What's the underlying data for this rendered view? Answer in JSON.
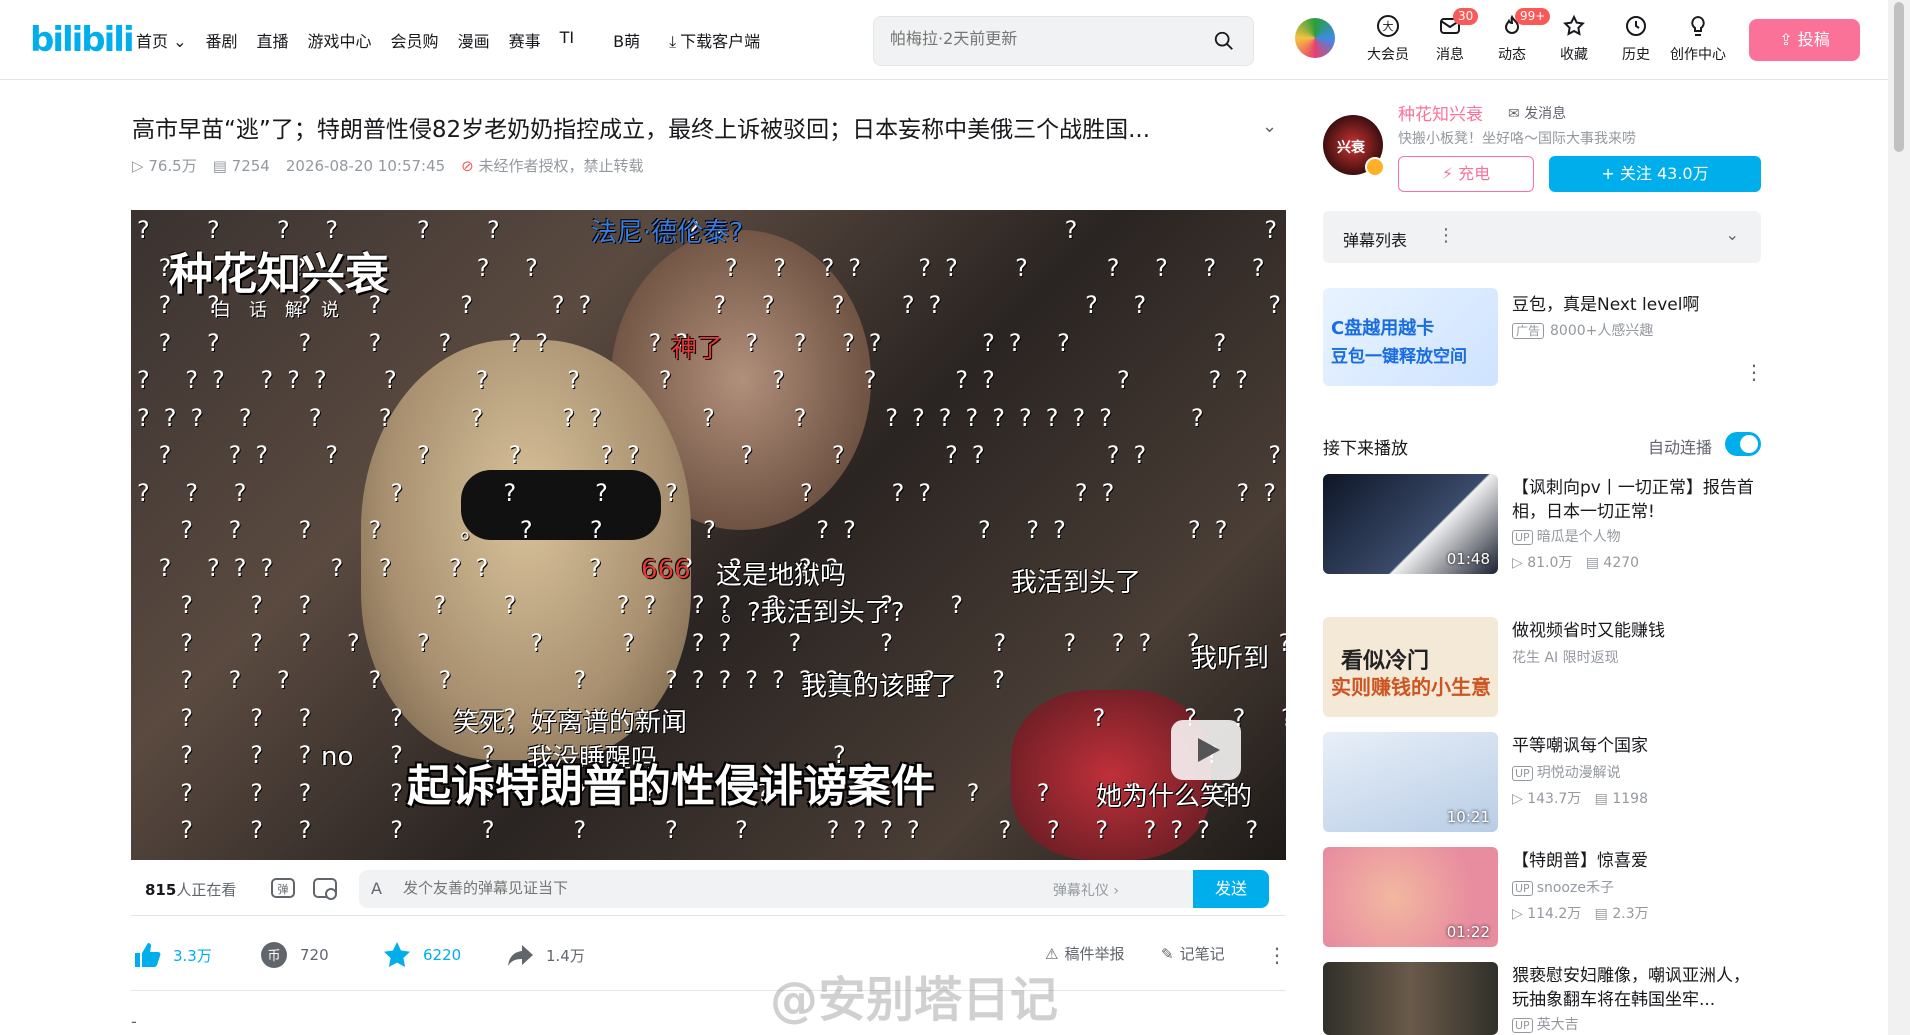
{
  "header": {
    "logo": "bilibili",
    "nav": [
      "首页 ⌄",
      "番剧",
      "直播",
      "游戏中心",
      "会员购",
      "漫画",
      "赛事",
      "TI",
      "B萌"
    ],
    "download": "下载客户端",
    "search_placeholder": "帕梅拉·2天前更新",
    "icons": [
      {
        "label": "大会员",
        "icon": "vip-icon",
        "badge": ""
      },
      {
        "label": "消息",
        "icon": "message-icon",
        "badge": "30"
      },
      {
        "label": "动态",
        "icon": "dynamic-icon",
        "badge": "99+"
      },
      {
        "label": "收藏",
        "icon": "favorite-icon",
        "badge": ""
      },
      {
        "label": "历史",
        "icon": "history-icon",
        "badge": ""
      },
      {
        "label": "创作中心",
        "icon": "creator-icon",
        "badge": ""
      }
    ],
    "upload": "投稿"
  },
  "video": {
    "title": "高市早苗“逃”了；特朗普性侵82岁老奶奶指控成立，最终上诉被驳回；日本妄称中美俄三个战胜国...",
    "views": "76.5万",
    "danmaku_count": "7254",
    "date": "2026-08-20 10:57:45",
    "copyright": "未经作者授权，禁止转载",
    "watermark_name": "种花知兴衰",
    "watermark_sub": "白话解说",
    "subtitle": "起诉特朗普的性侵诽谤案件",
    "danmaku": [
      {
        "text": "法尼·德伦泰?",
        "color": "blue"
      },
      {
        "text": "神了",
        "color": "red"
      },
      {
        "text": "666",
        "color": "red"
      },
      {
        "text": "这是地狱吗",
        "color": "white"
      },
      {
        "text": "我活到头了",
        "color": "white"
      },
      {
        "text": "。?我活到头了?",
        "color": "white"
      },
      {
        "text": "我真的该睡了",
        "color": "white"
      },
      {
        "text": "笑死，好离谱的新闻",
        "color": "white"
      },
      {
        "text": "我没睡醒吗",
        "color": "white"
      },
      {
        "text": "no",
        "color": "white"
      },
      {
        "text": "我听到",
        "color": "white"
      },
      {
        "text": "她为什么笑的",
        "color": "white"
      }
    ]
  },
  "sendbar": {
    "watching_count": "815",
    "watching_suffix": "人正在看",
    "input_placeholder": "发个友善的弹幕见证当下",
    "etiquette": "弹幕礼仪 ›",
    "send": "发送"
  },
  "actions": {
    "like": "3.3万",
    "coin": "720",
    "fav": "6220",
    "share": "1.4万",
    "report": "稿件举报",
    "note": "记笔记"
  },
  "watermark_bottom": "@安别塔日记",
  "uploader": {
    "name": "种花知兴衰",
    "message": "发消息",
    "desc": "快搬小板凳！坐好咯～国际大事我来唠",
    "charge": "充电",
    "follow": "+ 关注 43.0万"
  },
  "danmaku_list": {
    "title": "弹幕列表"
  },
  "ad": {
    "img_line1": "C盘越用越卡",
    "img_line2": "豆包一键释放空间",
    "title": "豆包，真是Next level啊",
    "tag": "广告",
    "sub": "8000+人感兴趣"
  },
  "next": {
    "title": "接下来播放",
    "autoplay": "自动连播"
  },
  "recommendations": [
    {
      "title": "【讽刺向pv丨一切正常】报告首相，日本一切正常!",
      "up": "暗瓜是个人物",
      "views": "81.0万",
      "danmaku": "4270",
      "duration": "01:48",
      "color": "#1a2030"
    },
    {
      "title": "做视频省时又能赚钱",
      "up": "花生 AI 限时返现",
      "views": "",
      "danmaku": "",
      "duration": "",
      "color": "#f4e8d6"
    },
    {
      "title": "平等嘲讽每个国家",
      "up": "玥悦动漫解说",
      "views": "143.7万",
      "danmaku": "1198",
      "duration": "10:21",
      "color": "#b8cde6"
    },
    {
      "title": "【特朗普】惊喜爱",
      "up": "snooze禾子",
      "views": "114.2万",
      "danmaku": "2.3万",
      "duration": "01:22",
      "color": "#e88ca0"
    },
    {
      "title": "猥亵慰安妇雕像，嘲讽亚洲人，玩抽象翻车将在韩国坐牢...",
      "up": "英大吉",
      "views": "",
      "danmaku": "",
      "duration": "",
      "color": "#30302a"
    }
  ]
}
